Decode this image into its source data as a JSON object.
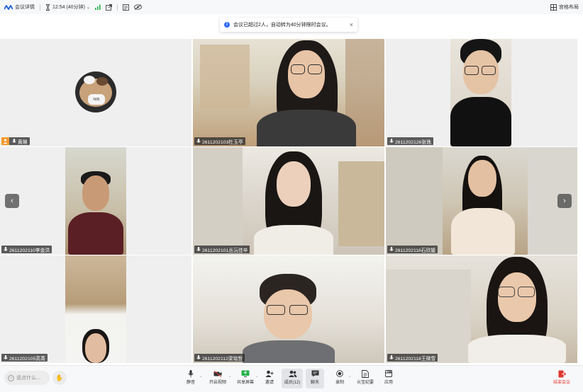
{
  "topbar": {
    "meeting_details": "会议详情",
    "timer": "12:54 (40分钟)",
    "layout_label": "宫格布局"
  },
  "toast": {
    "message": "会议已超过2人，自动转为40分钟限时会议。",
    "close": "×"
  },
  "participants": [
    {
      "name": "黄琳"
    },
    {
      "name": "2611202103杜玉亭"
    },
    {
      "name": "2611202126张逸"
    },
    {
      "name": "2611202110李金洪"
    },
    {
      "name": "2611202101丛沅佳辛"
    },
    {
      "name": "2611202116石欣媛"
    },
    {
      "name": "2611202105高菁"
    },
    {
      "name": "2611202112梁铭哲"
    },
    {
      "name": "2611202118王微雪"
    }
  ],
  "avatar_text": "N95",
  "nav": {
    "prev": "‹",
    "next": "›"
  },
  "bottombar": {
    "say_placeholder": "说点什么...",
    "tools": [
      {
        "label": "静音"
      },
      {
        "label": "开启视频"
      },
      {
        "label": "共享屏幕"
      },
      {
        "label": "邀请"
      },
      {
        "label": "成员(12)"
      },
      {
        "label": "聊天"
      },
      {
        "label": "录制"
      },
      {
        "label": "元宝纪要"
      },
      {
        "label": "应用"
      }
    ],
    "leave_label": "结束会议"
  },
  "colors": {
    "accent": "#2f6bf2",
    "leave": "#e0382f",
    "mic_green": "#25b34a",
    "host_orange": "#f29a2e"
  }
}
